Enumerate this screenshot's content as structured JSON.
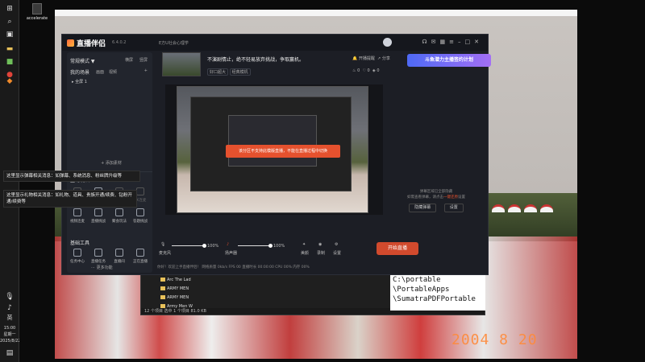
{
  "taskbar": {
    "icons": [
      "windows-logo-icon",
      "search-icon",
      "task-view-icon",
      "file-explorer-icon",
      "store-icon",
      "app-icon-red",
      "app-icon-orange"
    ],
    "ime": "英",
    "time": "15:00",
    "weekday": "星期一",
    "date": "2025/8/22"
  },
  "desktop": {
    "icon_label": "accelerate"
  },
  "photo": {
    "date_stamp": "2004 8 20"
  },
  "app": {
    "name": "直播伴侣",
    "version": "6.4.0.2",
    "top_center_title": "E方U社会心理学",
    "sidebar": {
      "mode_label": "常规模式 ▼",
      "landscape": "横屏",
      "portrait": "竖屏",
      "my_scenes": "我的场景",
      "scene_tabs": [
        "画面",
        "视频"
      ],
      "scene_item": "全屏 1",
      "add_material": "+ 添加素材",
      "interactive_title": "互动玩法",
      "interactive_items": [
        "观众连线",
        "主播PK",
        "多人连麦",
        "PK连麦",
        "视频连麦",
        "直播挑战",
        "聚会玩法",
        "答题挑战"
      ],
      "basic_tools_title": "基础工具",
      "basic_tools": [
        "任务中心",
        "直播任务",
        "直播间",
        "正在直播",
        "弹幕库",
        "发布主播",
        "直播回放",
        "下播包"
      ],
      "more": "更多功能"
    },
    "stream": {
      "title": "不演剧情止，绝不轻易放弃挑战，争取赢机。",
      "tags": [
        "好口超大",
        "经典模机"
      ],
      "links": [
        "开播提醒",
        "分享"
      ],
      "counts": [
        "0",
        "0",
        "0"
      ],
      "banner": "斗鱼潜力主播签约计划"
    },
    "preview": {
      "toast": "该分区不支持此模版直播，不能在直播过程中切换"
    },
    "right_panel": {
      "hint_line1": "弹幕区域已全部隐藏",
      "hint_line2": "如需查看弹幕，请点击",
      "hint_link": "一键还原",
      "hint_line3": "设置",
      "btn_hide": "隐藏弹幕",
      "btn_settings": "设置"
    },
    "controls": {
      "mic_label": "麦克风",
      "mic_value": "100%",
      "speaker_label": "扬声器",
      "speaker_value": "100%",
      "mic_level": 1.0,
      "speaker_level": 1.0,
      "tools": [
        "美颜",
        "录制",
        "设置"
      ],
      "start_button": "开始直播"
    },
    "statusbar": "你好！欢迎上手直播伴侣！   网络质量 0kb/s   FPS 00   直播时长 00:00:00   CPU 00%   内存 00%"
  },
  "tooltips": {
    "first": "这里显示弹幕相关消息：如弹幕、系统消息、粉丝牌升级等",
    "second": "这里显示礼物相关消息：如礼物、道具、贵族开通/续费、钻粉开通/续费等"
  },
  "explorer": {
    "rows": [
      "Arc The Lad",
      "ARMY MEN",
      "ARMY MEN",
      "Army Men W"
    ],
    "status": "12 个项目   选中 1 个项目  81.0 KB",
    "selected_count": "1 个项目"
  },
  "text_box": {
    "lines": [
      "C:\\portable",
      "\\PortableApps",
      "\\SumatraPDFPortable"
    ]
  }
}
